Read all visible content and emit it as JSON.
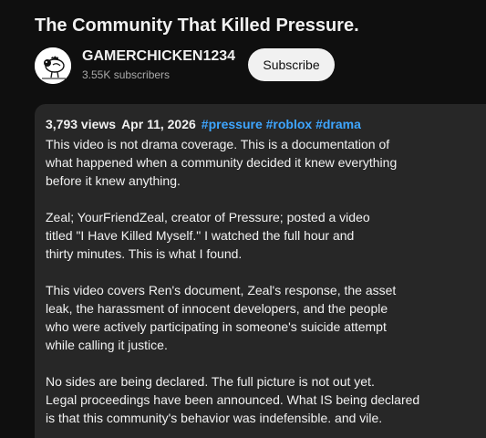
{
  "video": {
    "title": "The Community That Killed Pressure."
  },
  "channel": {
    "name": "GAMERCHICKEN1234",
    "subscribers": "3.55K subscribers",
    "subscribe_label": "Subscribe"
  },
  "description": {
    "views": "3,793 views",
    "date": "Apr 11, 2026",
    "hashtags": [
      "#pressure",
      "#roblox",
      "#drama"
    ],
    "paragraphs": [
      [
        "This video is not drama coverage. This is a documentation of",
        "what happened when a community decided it knew everything",
        "before it knew anything."
      ],
      [
        "Zeal; YourFriendZeal, creator of Pressure; posted a video",
        "titled \"I Have Killed Myself.\" I watched the full hour and",
        "thirty minutes. This is what I found."
      ],
      [
        "This video covers Ren's document, Zeal's response, the asset",
        "leak, the harassment of innocent developers, and the people",
        "who were actively participating in someone's suicide attempt",
        "while calling it justice."
      ],
      [
        "No sides are being declared. The full picture is not out yet.",
        "Legal proceedings have been announced. What IS being declared",
        "is that this community's behavior was indefensible. and vile."
      ]
    ]
  },
  "colors": {
    "background": "#0f0f0f",
    "description_bg": "#272727",
    "hashtag": "#3ea6ff",
    "subscribe_bg": "#f1f1f1",
    "secondary_text": "#aaaaaa"
  },
  "icons": {
    "avatar": "chicken-avatar"
  }
}
